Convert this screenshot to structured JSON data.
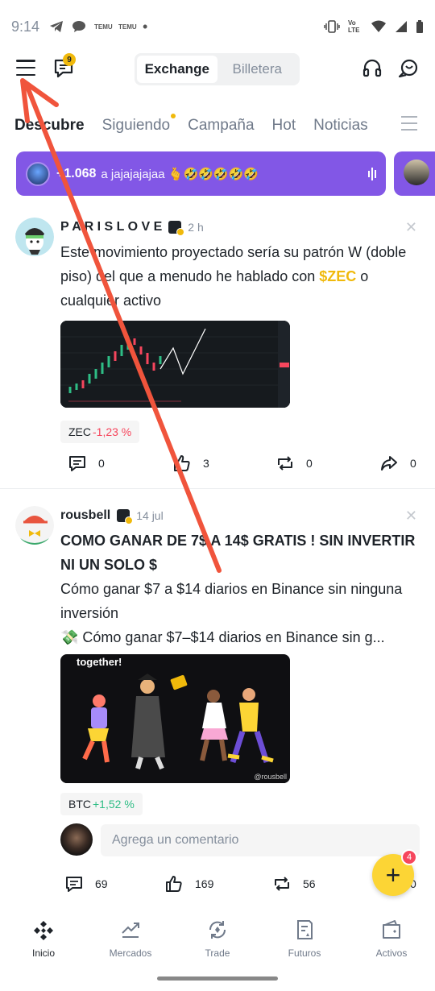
{
  "status_bar": {
    "time": "9:14",
    "notif_icons": [
      "telegram-icon",
      "chat-bubble-icon",
      "temu-icon",
      "temu-icon",
      "dot"
    ],
    "right_icons": [
      "vibrate-icon",
      "volte-icon",
      "wifi-icon",
      "signal-icon",
      "battery-icon"
    ],
    "volte_label": "Vo LTE",
    "temu_label": "TEMU"
  },
  "header": {
    "message_badge": "9",
    "toggle": {
      "exchange": "Exchange",
      "wallet": "Billetera"
    }
  },
  "tabs": [
    {
      "label": "Descubre"
    },
    {
      "label": "Siguiendo"
    },
    {
      "label": "Campaña"
    },
    {
      "label": "Hot"
    },
    {
      "label": "Noticias"
    }
  ],
  "live": {
    "count": "+1.068",
    "text": "a jajajajajaa 🫰🤣🤣🤣🤣🤣"
  },
  "posts": [
    {
      "author": "P A R I S L O V E",
      "time": "2 h",
      "text_before": "Este movimiento proyectado sería su patrón W (doble piso) del que a menudo he hablado con ",
      "ticker": "$ZEC",
      "text_after": " o cualquier activo",
      "coin": "ZEC",
      "change": "-1,23 %",
      "comments": "0",
      "likes": "3",
      "reposts": "0",
      "shares": "0"
    },
    {
      "author": "rousbell",
      "time": "14 jul",
      "title": "COMO GANAR DE 7$ A 14$ GRATIS ! SIN INVERTIR NI UN SOLO $",
      "line1": "Cómo ganar $7 a $14 diarios en Binance sin ninguna inversión",
      "line2": "💸 Cómo ganar $7–$14 diarios en Binance sin g...",
      "image_caption": "together!",
      "image_watermark": "@rousbell",
      "coin": "BTC",
      "change": "+1,52 %",
      "comment_placeholder": "Agrega un comentario",
      "comments": "69",
      "likes": "169",
      "reposts": "56",
      "shares": "0"
    }
  ],
  "fab": {
    "badge": "4"
  },
  "bottom_nav": [
    {
      "label": "Inicio"
    },
    {
      "label": "Mercados"
    },
    {
      "label": "Trade"
    },
    {
      "label": "Futuros"
    },
    {
      "label": "Activos"
    }
  ],
  "colors": {
    "brand_yellow": "#f0b90b",
    "live_purple": "#8257e6",
    "negative": "#f6465d",
    "positive": "#2ebd85",
    "annotation_arrow": "#f0543c"
  }
}
